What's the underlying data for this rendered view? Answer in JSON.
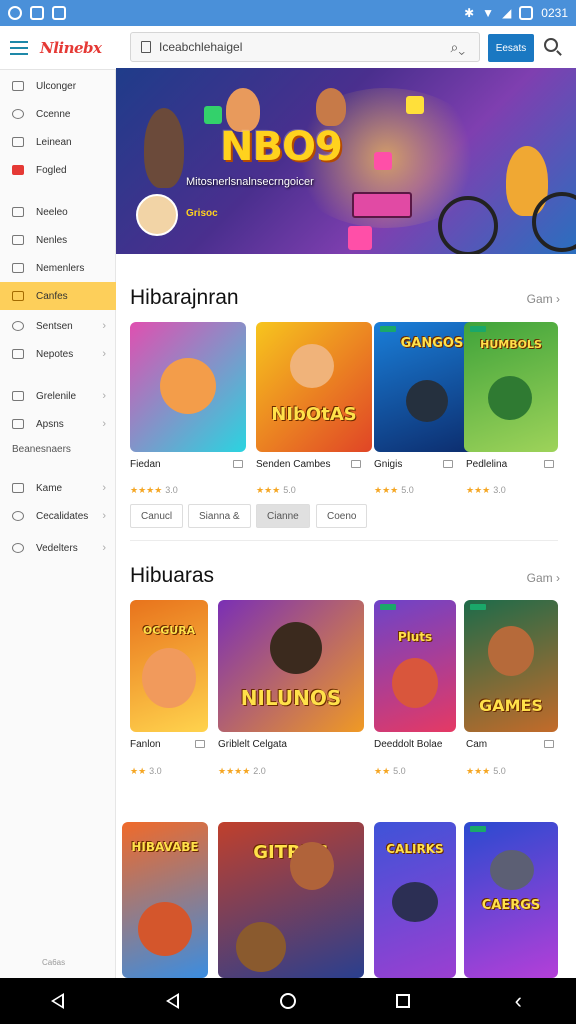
{
  "status_bar": {
    "time": "0231"
  },
  "app": {
    "logo": "Nlinebx"
  },
  "search": {
    "value": "Iceabchlehaigel",
    "button_label": "Eesats"
  },
  "sidebar": {
    "items": [
      {
        "label": "Ulconger",
        "icon": "grid-icon"
      },
      {
        "label": "Ccenne",
        "icon": "gear-icon"
      },
      {
        "label": "Leinean",
        "icon": "list-icon"
      },
      {
        "label": "Fogled",
        "icon": "app-red-icon"
      },
      {
        "label": "Neeleo",
        "icon": "grid-icon"
      },
      {
        "label": "Nenles",
        "icon": "image-icon"
      },
      {
        "label": "Nemenlers",
        "icon": "grid-icon"
      },
      {
        "label": "Canfes",
        "icon": "games-icon",
        "active": true
      },
      {
        "label": "Sentsen",
        "icon": "gear-icon"
      },
      {
        "label": "Nepotes",
        "icon": "grid-icon"
      },
      {
        "label": "Grelenile",
        "icon": "list-icon"
      },
      {
        "label": "Apsns",
        "icon": "list-icon"
      },
      {
        "label": "Kame",
        "icon": "grid-icon"
      },
      {
        "label": "Cecalidates",
        "icon": "circle-icon"
      },
      {
        "label": "Vedelters",
        "icon": "circle-icon"
      }
    ],
    "section_label": "Beanesnaers",
    "footer": "Ca6as"
  },
  "hero": {
    "title": "NBO9",
    "tagline": "Mitosnerlsnalnsecrngoicer",
    "avatar_label": "Grisoc"
  },
  "section1": {
    "title": "Hibarajnran",
    "more": "Gam",
    "cards": [
      {
        "name": "Fiedan",
        "rating": "★★★★",
        "score": "3.0",
        "art": "",
        "colors": [
          "#e04fb0",
          "#2ad4e0"
        ]
      },
      {
        "name": "Senden Cambes",
        "rating": "★★★",
        "score": "5.0",
        "art": "NIbOtAS",
        "colors": [
          "#f7c51e",
          "#e04526"
        ]
      },
      {
        "name": "Gnigis",
        "rating": "★★★",
        "score": "5.0",
        "art": "GANGOS",
        "colors": [
          "#1a7fd9",
          "#0c2a6a"
        ]
      },
      {
        "name": "Pedlelina",
        "rating": "★★★",
        "score": "3.0",
        "art": "HUMBOLS",
        "colors": [
          "#3fa33a",
          "#9ed35a"
        ]
      }
    ],
    "chips": [
      {
        "label": "Canucl",
        "active": false
      },
      {
        "label": "Sianna &",
        "active": false
      },
      {
        "label": "Cianne",
        "active": true
      },
      {
        "label": "Coeno",
        "active": false
      }
    ]
  },
  "section2": {
    "title": "Hibuaras",
    "more": "Gam",
    "cards": [
      {
        "name": "Fanlon",
        "rating": "★★",
        "score": "3.0",
        "art": "OCGURA",
        "colors": [
          "#e8731c",
          "#ffd34d"
        ]
      },
      {
        "name": "Griblelt Celgata",
        "rating": "★★★★",
        "score": "2.0",
        "art": "NILUNOS",
        "colors": [
          "#7a2fb5",
          "#f09a24"
        ]
      },
      {
        "name": "Deeddolt Bolae",
        "rating": "★★",
        "score": "5.0",
        "art": "Pluts",
        "colors": [
          "#6d43c9",
          "#e53964"
        ]
      },
      {
        "name": "Cam",
        "rating": "★★★",
        "score": "5.0",
        "art": "GAMES",
        "colors": [
          "#1d6b4a",
          "#c36b2a"
        ]
      }
    ]
  },
  "section3": {
    "cards": [
      {
        "art": "HIBAVABE",
        "colors": [
          "#f06a2a",
          "#3b8de0"
        ]
      },
      {
        "art": "GITRDS",
        "colors": [
          "#c0402c",
          "#2a3f8e"
        ]
      },
      {
        "art": "CALIRKS",
        "colors": [
          "#3e53d8",
          "#9b3fd1"
        ]
      },
      {
        "art": "CAERGS",
        "colors": [
          "#2a4ad0",
          "#b43fd8"
        ]
      }
    ]
  }
}
